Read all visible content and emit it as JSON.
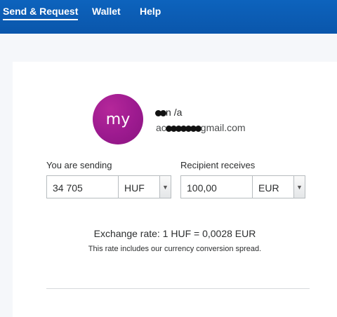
{
  "nav": {
    "items": [
      {
        "label": "Send & Request"
      },
      {
        "label": "Wallet"
      },
      {
        "label": "Help"
      }
    ]
  },
  "recipient": {
    "avatar_initials": "my",
    "name_visible_parts": [
      "n",
      "/a"
    ],
    "email_visible_parts": [
      "ac",
      "gmail.com"
    ]
  },
  "sending": {
    "label": "You are sending",
    "amount": "34 705",
    "currency": "HUF"
  },
  "receiving": {
    "label": "Recipient receives",
    "amount": "100,00",
    "currency": "EUR"
  },
  "exchange": {
    "rate_text": "Exchange rate: 1 HUF = 0,0028 EUR",
    "note": "This rate includes our currency conversion spread."
  },
  "colors": {
    "topbar": "#0b5fb8",
    "avatar": "#9c1a8f"
  }
}
